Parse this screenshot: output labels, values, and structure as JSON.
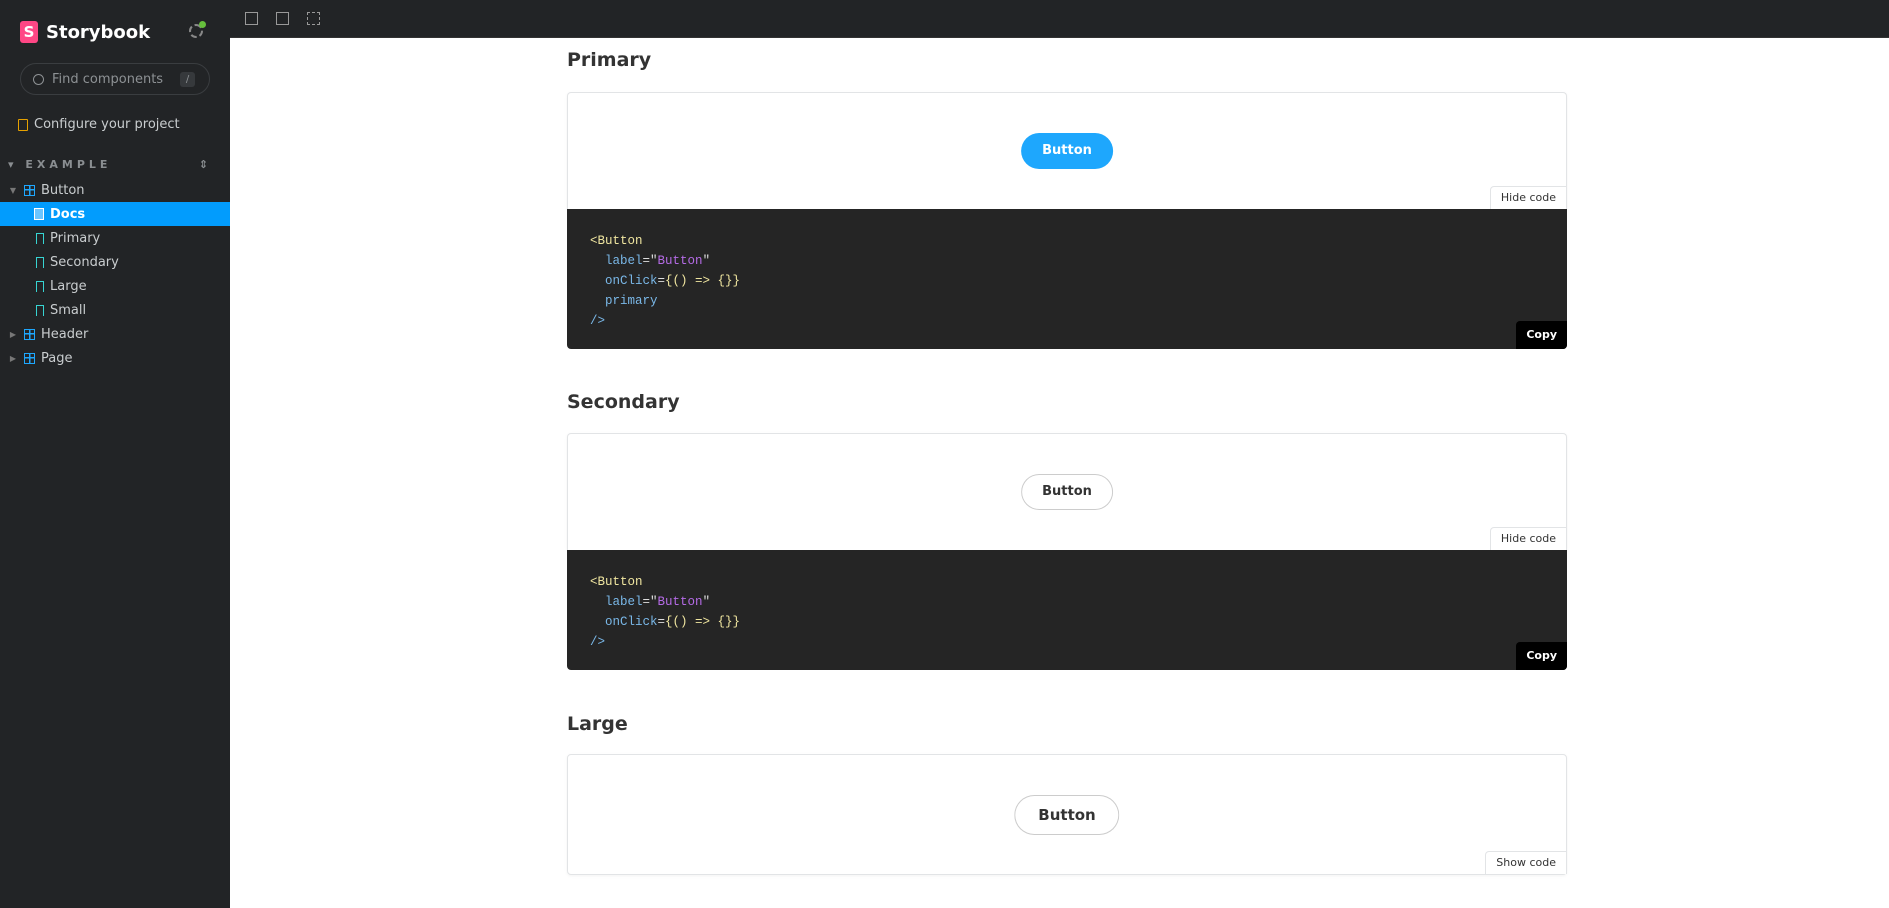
{
  "app": {
    "name": "Storybook",
    "brand_color": "#ff4785"
  },
  "search": {
    "placeholder": "Find components",
    "shortcut": "/"
  },
  "sidebar": {
    "configure": "Configure your project",
    "group": "EXAMPLE",
    "items": [
      {
        "label": "Button",
        "type": "component",
        "expanded": true
      },
      {
        "label": "Docs",
        "type": "docs",
        "selected": true
      },
      {
        "label": "Primary",
        "type": "story"
      },
      {
        "label": "Secondary",
        "type": "story"
      },
      {
        "label": "Large",
        "type": "story"
      },
      {
        "label": "Small",
        "type": "story"
      },
      {
        "label": "Header",
        "type": "component",
        "expanded": false
      },
      {
        "label": "Page",
        "type": "component",
        "expanded": false
      }
    ]
  },
  "stories": [
    {
      "title": "Primary",
      "button": "Button",
      "toggle": "Hide code",
      "copy": "Copy",
      "code": {
        "tag": "Button",
        "label_attr": "label",
        "label_val": "Button",
        "onclick_attr": "onClick",
        "onclick_val": "{() => {}}",
        "flag": "primary"
      }
    },
    {
      "title": "Secondary",
      "button": "Button",
      "toggle": "Hide code",
      "copy": "Copy",
      "code": {
        "tag": "Button",
        "label_attr": "label",
        "label_val": "Button",
        "onclick_attr": "onClick",
        "onclick_val": "{() => {}}"
      }
    },
    {
      "title": "Large",
      "button": "Button",
      "toggle": "Show code"
    }
  ],
  "colors": {
    "accent": "#029cfd",
    "primary_button": "#1ea7fd"
  }
}
